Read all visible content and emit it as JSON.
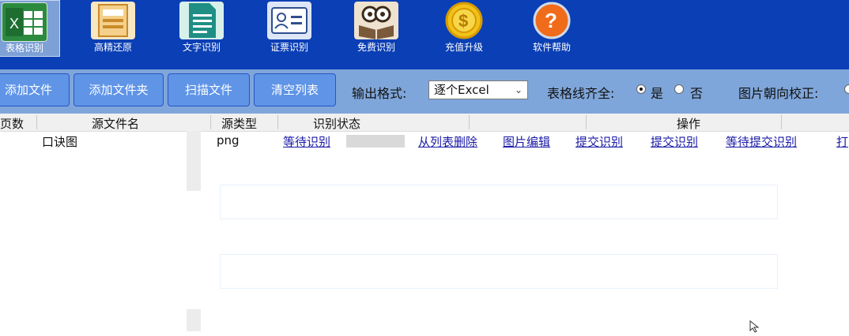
{
  "toolbar": {
    "items": [
      {
        "label": "表格识别",
        "icon": "excel-icon",
        "active": true
      },
      {
        "label": "高精还原",
        "icon": "document-restore-icon"
      },
      {
        "label": "文字识别",
        "icon": "text-document-icon"
      },
      {
        "label": "证票识别",
        "icon": "id-card-icon"
      },
      {
        "label": "免费识别",
        "icon": "reading-owl-icon"
      },
      {
        "label": "充值升级",
        "icon": "gold-coin-icon"
      },
      {
        "label": "软件帮助",
        "icon": "help-icon"
      }
    ]
  },
  "actions": {
    "add_file": "添加文件",
    "add_folder": "添加文件夹",
    "scan_file": "扫描文件",
    "clear_list": "清空列表"
  },
  "options": {
    "output_format_label": "输出格式:",
    "output_format_value": "逐个Excel",
    "table_line_label": "表格线齐全:",
    "yes_label": "是",
    "no_label": "否",
    "orientation_label": "图片朝向校正:"
  },
  "table": {
    "headers": {
      "pages": "页数",
      "source_name": "源文件名",
      "source_type": "源类型",
      "status": "识别状态",
      "operation": "操作"
    },
    "rows": [
      {
        "name": "口诀图",
        "type": "png",
        "status": "等待识别",
        "progress": 0,
        "ops": [
          "从列表删除",
          "图片编辑",
          "提交识别",
          "提交识别",
          "等待提交识别",
          "打"
        ]
      }
    ]
  },
  "colors": {
    "top_bar": "#0b3fb5",
    "second_bar": "#7fa6da",
    "button": "#5f94e6",
    "link": "#1a1aa6"
  }
}
